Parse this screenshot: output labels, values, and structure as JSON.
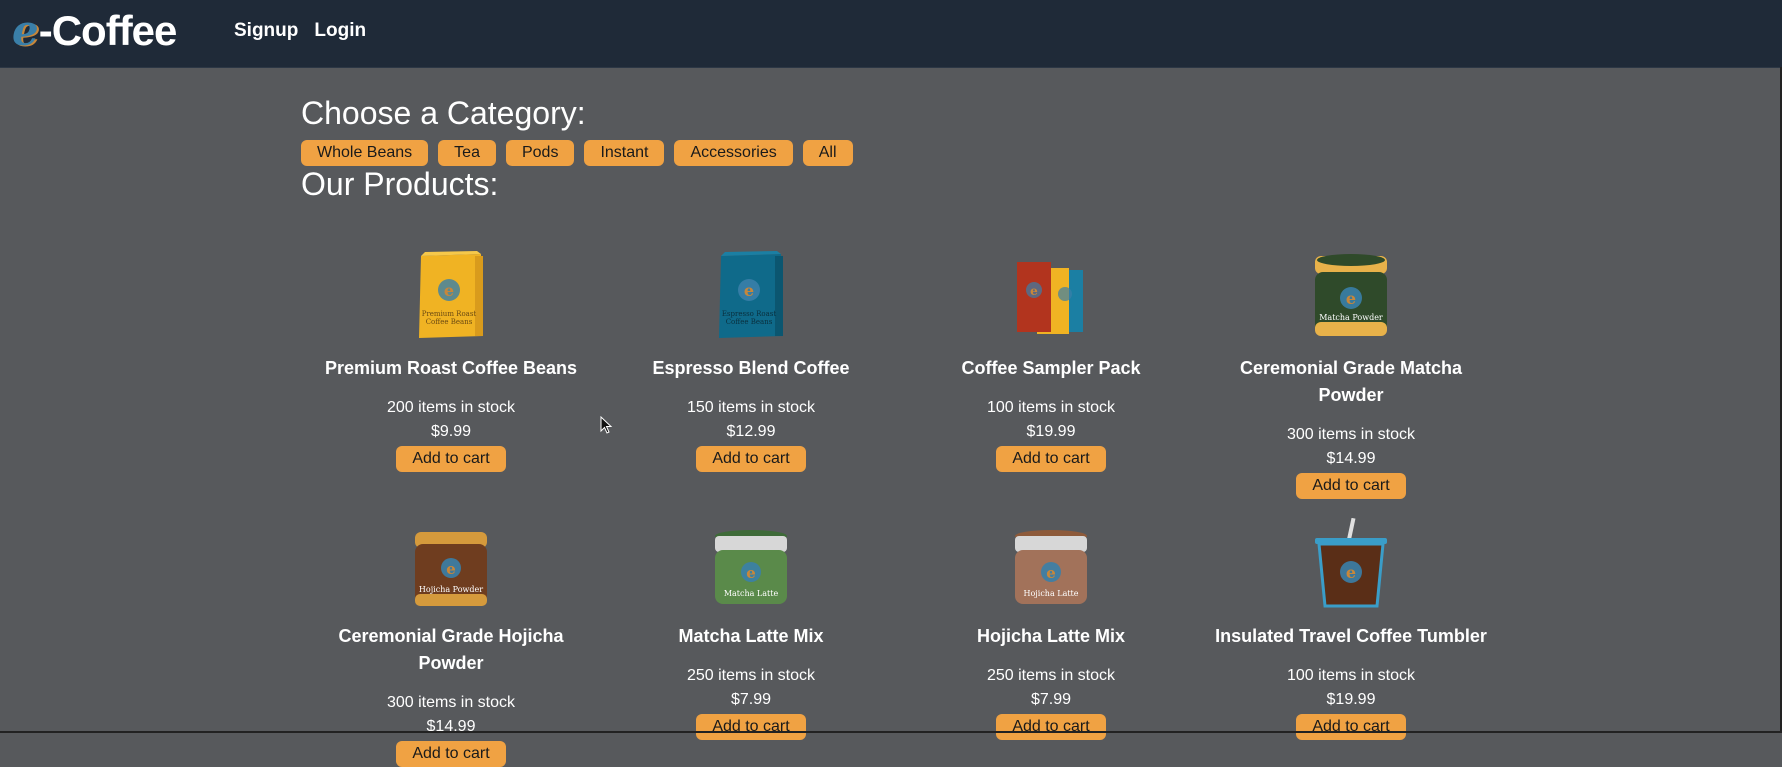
{
  "header": {
    "logo_mark": "e",
    "logo_text": "-Coffee",
    "nav": [
      "Signup",
      "Login"
    ]
  },
  "categories": {
    "title": "Choose a Category:",
    "items": [
      "Whole Beans",
      "Tea",
      "Pods",
      "Instant",
      "Accessories",
      "All"
    ]
  },
  "products": {
    "title": "Our Products:",
    "add_label": "Add to cart",
    "items": [
      {
        "name": "Premium Roast Coffee Beans",
        "stock": "200 items in stock",
        "price": "$9.99",
        "icon": "yellow-coffee-bag-icon"
      },
      {
        "name": "Espresso Blend Coffee",
        "stock": "150 items in stock",
        "price": "$12.99",
        "icon": "blue-coffee-bag-icon"
      },
      {
        "name": "Coffee Sampler Pack",
        "stock": "100 items in stock",
        "price": "$19.99",
        "icon": "sampler-bags-icon"
      },
      {
        "name": "Ceremonial Grade Matcha Powder",
        "stock": "300 items in stock",
        "price": "$14.99",
        "icon": "matcha-jar-icon"
      },
      {
        "name": "Ceremonial Grade Hojicha Powder",
        "stock": "300 items in stock",
        "price": "$14.99",
        "icon": "hojicha-jar-icon"
      },
      {
        "name": "Matcha Latte Mix",
        "stock": "250 items in stock",
        "price": "$7.99",
        "icon": "matcha-latte-jar-icon"
      },
      {
        "name": "Hojicha Latte Mix",
        "stock": "250 items in stock",
        "price": "$7.99",
        "icon": "hojicha-latte-jar-icon"
      },
      {
        "name": "Insulated Travel Coffee Tumbler",
        "stock": "100 items in stock",
        "price": "$19.99",
        "icon": "tumbler-icon"
      }
    ],
    "labels": {
      "bag1": [
        "Premium Roast",
        "Coffee Beans"
      ],
      "bag2": [
        "Espresso Roast",
        "Coffee Beans"
      ],
      "jar1": "Matcha Powder",
      "jar2": "Hojicha Powder",
      "jar3": "Matcha Latte",
      "jar4": "Hojicha Latte"
    }
  },
  "colors": {
    "accent": "#f0a243",
    "header_bg": "#1f2a38",
    "page_bg": "#57595c"
  }
}
